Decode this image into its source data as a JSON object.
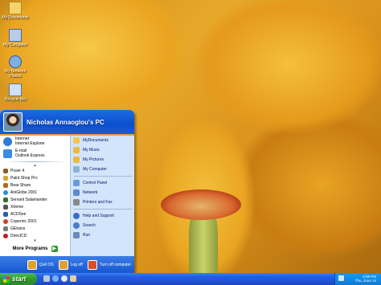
{
  "desktop": {
    "icons": [
      {
        "label": "My Documents",
        "icon": "my-documents-icon",
        "color": "#f2d36c"
      },
      {
        "label": "My Computer",
        "icon": "my-computer-icon",
        "color": "#b9cde8"
      },
      {
        "label": "My Network Places",
        "icon": "network-places-icon",
        "color": "#7fb0e4"
      },
      {
        "label": "Recycle Bin",
        "icon": "recycle-bin-icon",
        "color": "#cfe0f0"
      }
    ]
  },
  "start_menu": {
    "user_name": "Nicholas Annaoglou's PC",
    "pinned": [
      {
        "line1": "Internet",
        "line2": "Internet Explorer",
        "icon": "internet-explorer-icon",
        "color": "#2e7cd8"
      },
      {
        "line1": "E-mail",
        "line2": "Outlook Express",
        "icon": "outlook-express-icon",
        "color": "#3b8be0"
      }
    ],
    "recent_programs": [
      {
        "label": "Poser 4",
        "icon": "poser-icon",
        "color": "#8a5a2a"
      },
      {
        "label": "Paint Shop Pro",
        "icon": "paint-shop-pro-icon",
        "color": "#d6a233"
      },
      {
        "label": "Bear Share",
        "icon": "bearshare-icon",
        "color": "#b2681f"
      },
      {
        "label": "AniGlobe 2001",
        "icon": "aniglobe-icon",
        "color": "#2a8fd6"
      },
      {
        "label": "Servant Salamander",
        "icon": "salamander-icon",
        "color": "#3a6f2a"
      },
      {
        "label": "Xtreme",
        "icon": "xtreme-icon",
        "color": "#555555"
      },
      {
        "label": "ACDSee",
        "icon": "acdsee-icon",
        "color": "#2060b0"
      },
      {
        "label": "Copernic 2001",
        "icon": "copernic-icon",
        "color": "#d04020"
      },
      {
        "label": "GEtrans",
        "icon": "getrans-icon",
        "color": "#7a7a7a"
      },
      {
        "label": "DirectCD",
        "icon": "directcd-icon",
        "color": "#c02020"
      }
    ],
    "all_programs_label": "More Programs",
    "right_items": [
      {
        "label": "MyDocuments",
        "icon": "my-documents-icon",
        "color": "#f2c84a",
        "small": false
      },
      {
        "label": "My Music",
        "icon": "my-music-icon",
        "color": "#f0b840",
        "small": false
      },
      {
        "label": "My Pictures",
        "icon": "my-pictures-icon",
        "color": "#f0b840",
        "small": false
      },
      {
        "label": "My Computer",
        "icon": "my-computer-icon",
        "color": "#8fb0d8",
        "small": false
      },
      {
        "label": "Control Panel",
        "icon": "control-panel-icon",
        "color": "#6a9ad8",
        "small": false
      },
      {
        "label": "Network",
        "icon": "network-icon",
        "color": "#5a8ad0",
        "small": false
      },
      {
        "label": "Printers and Fax",
        "icon": "printer-icon",
        "color": "#8a8a8a",
        "small": false
      },
      {
        "label": "Help and Support",
        "icon": "help-icon",
        "color": "#3a6ad0",
        "small": false
      },
      {
        "label": "Search",
        "icon": "search-icon",
        "color": "#4a7ac8",
        "small": false
      },
      {
        "label": "Run",
        "icon": "run-icon",
        "color": "#6a8ab8",
        "small": false
      }
    ],
    "footer": {
      "quit_label": "Quit OS",
      "logoff_label": "Log off",
      "turnoff_label": "Turn off computer",
      "quit_color": "#e0a030",
      "logoff_color": "#e0a030",
      "turnoff_color": "#d8502a"
    }
  },
  "taskbar": {
    "start_label": "start",
    "quick_launch": [
      {
        "icon": "desktop-icon",
        "color": "#b8c8e0"
      },
      {
        "icon": "internet-explorer-icon",
        "color": "#7ab0f0"
      },
      {
        "icon": "media-player-icon",
        "color": "#e0e8f0"
      },
      {
        "icon": "outlook-express-icon",
        "color": "#e0d0a0"
      }
    ],
    "clock_time": "4:08 PM",
    "clock_date": "Thu, June 14"
  }
}
